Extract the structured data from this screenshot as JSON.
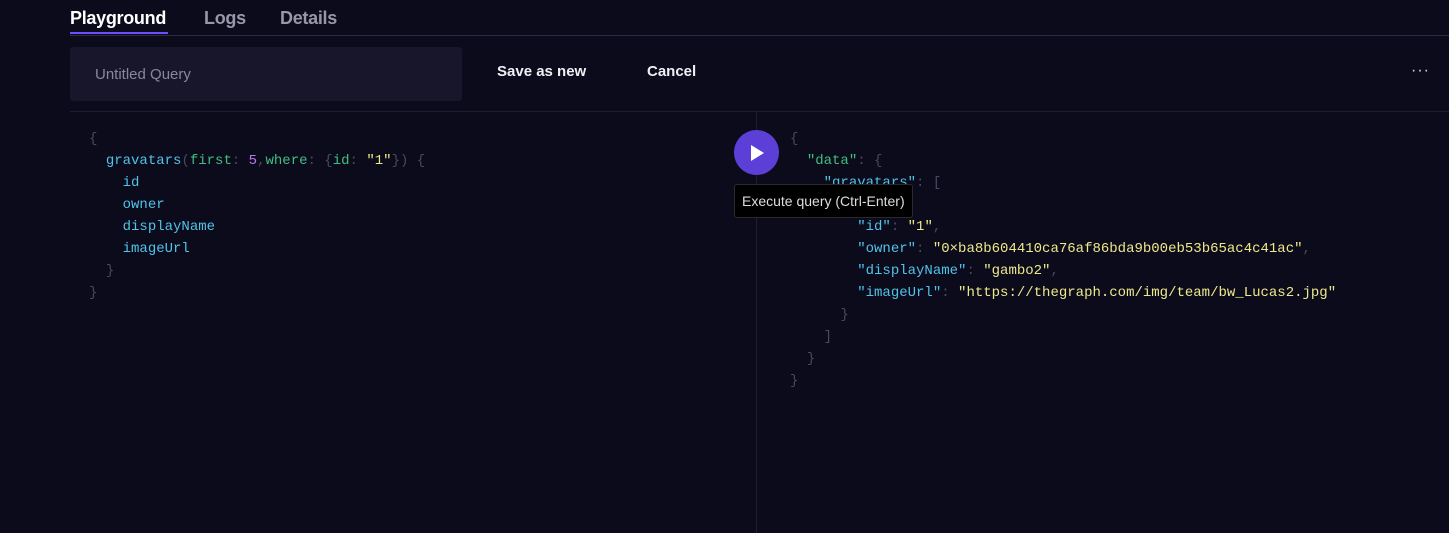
{
  "tabs": [
    {
      "label": "Playground",
      "active": true
    },
    {
      "label": "Logs",
      "active": false
    },
    {
      "label": "Details",
      "active": false
    }
  ],
  "query_name": {
    "value": "",
    "placeholder": "Untitled Query"
  },
  "toolbar": {
    "save_as_new": "Save as new",
    "cancel": "Cancel",
    "more": "···"
  },
  "accent_color": "#6f4cff",
  "play_button": {
    "icon": "play-icon",
    "tooltip": "Execute query (Ctrl-Enter)"
  },
  "query_editor": {
    "lines": [
      [
        [
          "{",
          "punct"
        ]
      ],
      [
        [
          "  ",
          ""
        ],
        [
          "gravatars",
          "field"
        ],
        [
          "(",
          "punct"
        ],
        [
          "first",
          "arg"
        ],
        [
          ": ",
          "punct"
        ],
        [
          "5",
          "num"
        ],
        [
          ",",
          "punct"
        ],
        [
          "where",
          "arg"
        ],
        [
          ": {",
          "punct"
        ],
        [
          "id",
          "arg"
        ],
        [
          ": ",
          "punct"
        ],
        [
          "\"1\"",
          "str"
        ],
        [
          "}) {",
          "punct"
        ]
      ],
      [
        [
          "    ",
          ""
        ],
        [
          "id",
          "field"
        ]
      ],
      [
        [
          "    ",
          ""
        ],
        [
          "owner",
          "field"
        ]
      ],
      [
        [
          "    ",
          ""
        ],
        [
          "displayName",
          "field"
        ]
      ],
      [
        [
          "    ",
          ""
        ],
        [
          "imageUrl",
          "field"
        ]
      ],
      [
        [
          "  ",
          ""
        ],
        [
          "}",
          "punct"
        ]
      ],
      [
        [
          "}",
          "punct"
        ]
      ]
    ]
  },
  "result_viewer": {
    "lines": [
      [
        [
          "{",
          "punct"
        ]
      ],
      [
        [
          "  ",
          ""
        ],
        [
          "\"data\"",
          "datakey"
        ],
        [
          ": {",
          "punct"
        ]
      ],
      [
        [
          "    ",
          ""
        ],
        [
          "\"gravatars\"",
          "key"
        ],
        [
          ": [",
          "punct"
        ]
      ],
      [
        [
          "      ",
          ""
        ],
        [
          "{",
          "punct"
        ]
      ],
      [
        [
          "        ",
          ""
        ],
        [
          "\"id\"",
          "key"
        ],
        [
          ": ",
          "punct"
        ],
        [
          "\"1\"",
          "str"
        ],
        [
          ",",
          "punct"
        ]
      ],
      [
        [
          "        ",
          ""
        ],
        [
          "\"owner\"",
          "key"
        ],
        [
          ": ",
          "punct"
        ],
        [
          "\"0×ba8b604410ca76af86bda9b00eb53b65ac4c41ac\"",
          "str"
        ],
        [
          ",",
          "punct"
        ]
      ],
      [
        [
          "        ",
          ""
        ],
        [
          "\"displayName\"",
          "key"
        ],
        [
          ": ",
          "punct"
        ],
        [
          "\"gambo2\"",
          "str"
        ],
        [
          ",",
          "punct"
        ]
      ],
      [
        [
          "        ",
          ""
        ],
        [
          "\"imageUrl\"",
          "key"
        ],
        [
          ": ",
          "punct"
        ],
        [
          "\"https://thegraph.com/img/team/bw_Lucas2.jpg\"",
          "str"
        ]
      ],
      [
        [
          "      ",
          ""
        ],
        [
          "}",
          "punct"
        ]
      ],
      [
        [
          "    ",
          ""
        ],
        [
          "]",
          "punct"
        ]
      ],
      [
        [
          "  ",
          ""
        ],
        [
          "}",
          "punct"
        ]
      ],
      [
        [
          "}",
          "punct"
        ]
      ]
    ]
  }
}
